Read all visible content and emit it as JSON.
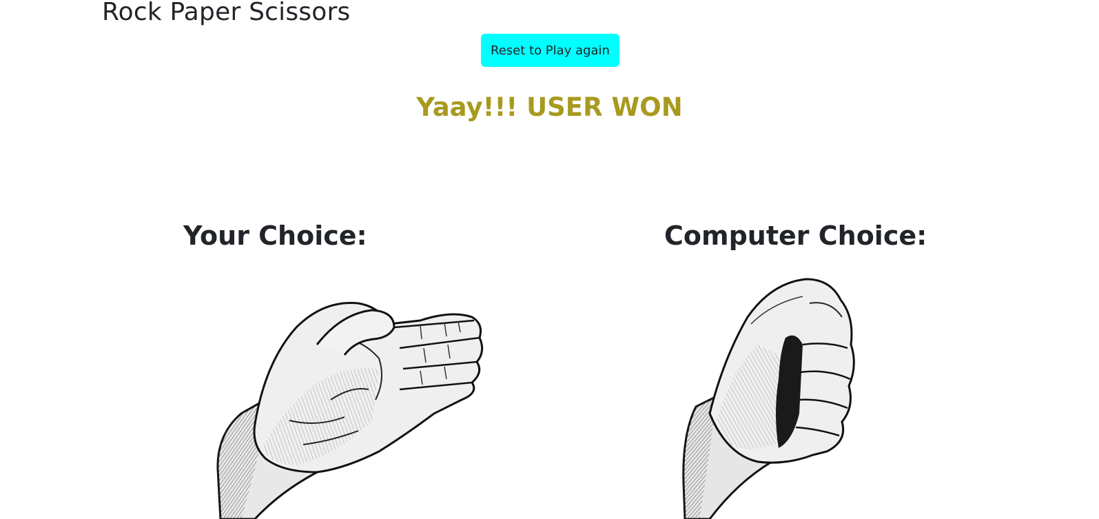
{
  "header": {
    "title": "Rock Paper Scissors"
  },
  "controls": {
    "reset_label": "Reset to Play again"
  },
  "result": {
    "message": "Yaay!!! USER WON",
    "color": "#a89a1f"
  },
  "choices": {
    "user": {
      "heading": "Your Choice:",
      "choice_icon": "paper-hand-icon"
    },
    "computer": {
      "heading": "Computer Choice:",
      "choice_icon": "rock-fist-icon"
    }
  },
  "colors": {
    "button_bg": "#00ffff",
    "text": "#212529"
  }
}
